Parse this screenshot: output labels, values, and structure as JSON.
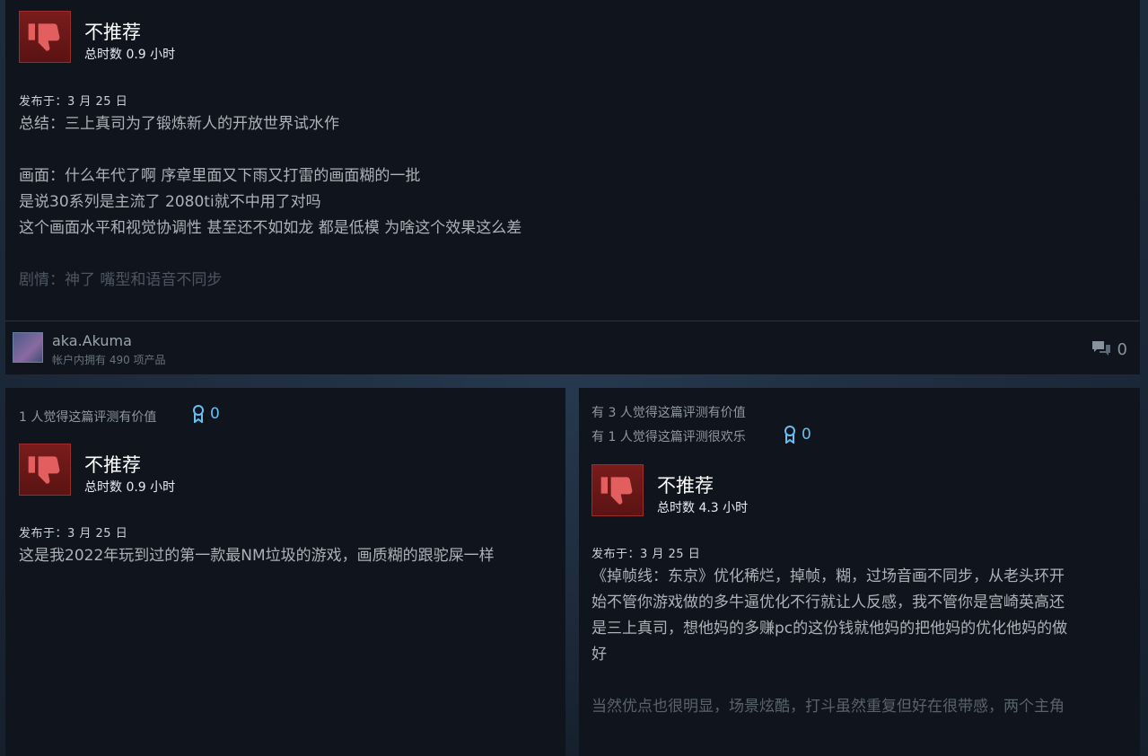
{
  "reviews": [
    {
      "recommendation": "不推荐",
      "hours": "总时数 0.9 小时",
      "posted": "发布于：3 月 25 日",
      "lines": [
        "总结：三上真司为了锻炼新人的开放世界试水作",
        "",
        "画面：什么年代了啊 序章里面又下雨又打雷的画面糊的一批",
        "是说30系列是主流了 2080ti就不中用了对吗",
        "这个画面水平和视觉协调性 甚至还不如如龙 都是低模 为啥这个效果这么差",
        "",
        "剧情：神了 嘴型和语音不同步"
      ],
      "author": "aka.Akuma",
      "products": "帐户内拥有 490 项产品",
      "comment_count": "0"
    },
    {
      "helpful_lines": [
        "1 人觉得这篇评测有价值"
      ],
      "award_count": "0",
      "recommendation": "不推荐",
      "hours": "总时数 0.9 小时",
      "posted": "发布于：3 月 25 日",
      "lines": [
        "这是我2022年玩到过的第一款最NM垃圾的游戏，画质糊的跟驼屎一样"
      ]
    },
    {
      "helpful_lines": [
        "有 3 人觉得这篇评测有价值",
        "有 1 人觉得这篇评测很欢乐"
      ],
      "award_count": "0",
      "recommendation": "不推荐",
      "hours": "总时数 4.3 小时",
      "posted": "发布于：3 月 25 日",
      "lines": [
        "《掉帧线：东京》优化稀烂，掉帧，糊，过场音画不同步，从老头环开",
        "始不管你游戏做的多牛逼优化不行就让人反感，我不管你是宫崎英高还",
        "是三上真司，想他妈的多赚pc的这份钱就他妈的把他妈的优化他妈的做",
        "好",
        "",
        "当然优点也很明显，场景炫酷，打斗虽然重复但好在很带感，两个主角"
      ]
    }
  ],
  "colors": {
    "background": "#1b2838",
    "card": "#0f141d",
    "thumb": "#7a1c1c",
    "thumb_icon": "#e35f5f",
    "award": "#66c0f4"
  },
  "icons": {
    "thumb": "thumbs-down-icon",
    "comment": "comment-bubble-icon",
    "award": "award-ribbon-icon"
  }
}
